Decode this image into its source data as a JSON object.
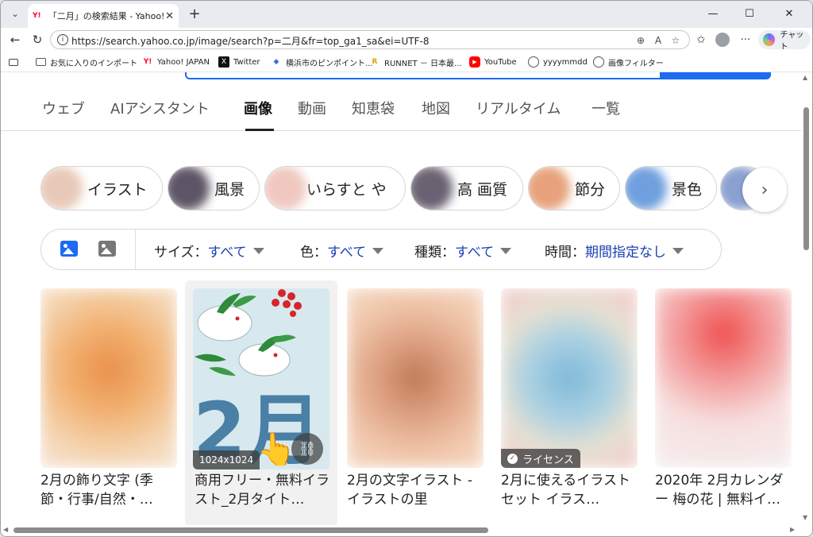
{
  "browser": {
    "tab_title": "「二月」の検索結果 - Yahoo!検索（画像）",
    "tab_favicon": "Y!",
    "url": "https://search.yahoo.co.jp/image/search?p=二月&fr=top_ga1_sa&ei=UTF-8",
    "chat_label": "チャット",
    "bookmarks": [
      {
        "label": "お気に入りのインポート",
        "icon": "folder-icon"
      },
      {
        "label": "Yahoo! JAPAN",
        "icon": "yahoo-icon"
      },
      {
        "label": "Twitter",
        "icon": "x-icon"
      },
      {
        "label": "横浜市のピンポイント...",
        "icon": "weather-icon"
      },
      {
        "label": "RUNNET － 日本最...",
        "icon": "runnet-icon"
      },
      {
        "label": "YouTube",
        "icon": "youtube-icon"
      },
      {
        "label": "yyyymmdd",
        "icon": "globe-icon"
      },
      {
        "label": "画像フィルター",
        "icon": "globe-icon"
      }
    ]
  },
  "vertical_tabs": [
    {
      "label": "ウェブ",
      "active": false
    },
    {
      "label": "AIアシスタント",
      "active": false
    },
    {
      "label": "画像",
      "active": true
    },
    {
      "label": "動画",
      "active": false
    },
    {
      "label": "知恵袋",
      "active": false
    },
    {
      "label": "地図",
      "active": false
    },
    {
      "label": "リアルタイム",
      "active": false
    },
    {
      "label": "一覧",
      "active": false
    }
  ],
  "chips": [
    {
      "label": "イラスト"
    },
    {
      "label": "風景"
    },
    {
      "label": "いらすと や"
    },
    {
      "label": "高 画質"
    },
    {
      "label": "節分"
    },
    {
      "label": "景色"
    }
  ],
  "filters": {
    "size": {
      "label": "サイズ：",
      "value": "すべて"
    },
    "color": {
      "label": "色：",
      "value": "すべて"
    },
    "type": {
      "label": "種類：",
      "value": "すべて"
    },
    "time": {
      "label": "時間：",
      "value": "期間指定なし"
    }
  },
  "results": [
    {
      "caption": "2月の飾り文字 (季節・行事/自然・…",
      "badge": ""
    },
    {
      "caption": "商用フリー・無料イラスト_2月タイト…",
      "badge": "1024x1024"
    },
    {
      "caption": "2月の文字イラスト - イラストの里",
      "badge": ""
    },
    {
      "caption": "2月に使えるイラストセット イラス…",
      "badge": "ライセンス"
    },
    {
      "caption": "2020年 2月カレンダー 梅の花 | 無料イ…",
      "badge": ""
    }
  ],
  "hovered_image_text": "2月",
  "colors": {
    "accent": "#1c6bf0",
    "filter_value": "#1a3fb5",
    "yahoo_red": "#ff0033"
  }
}
